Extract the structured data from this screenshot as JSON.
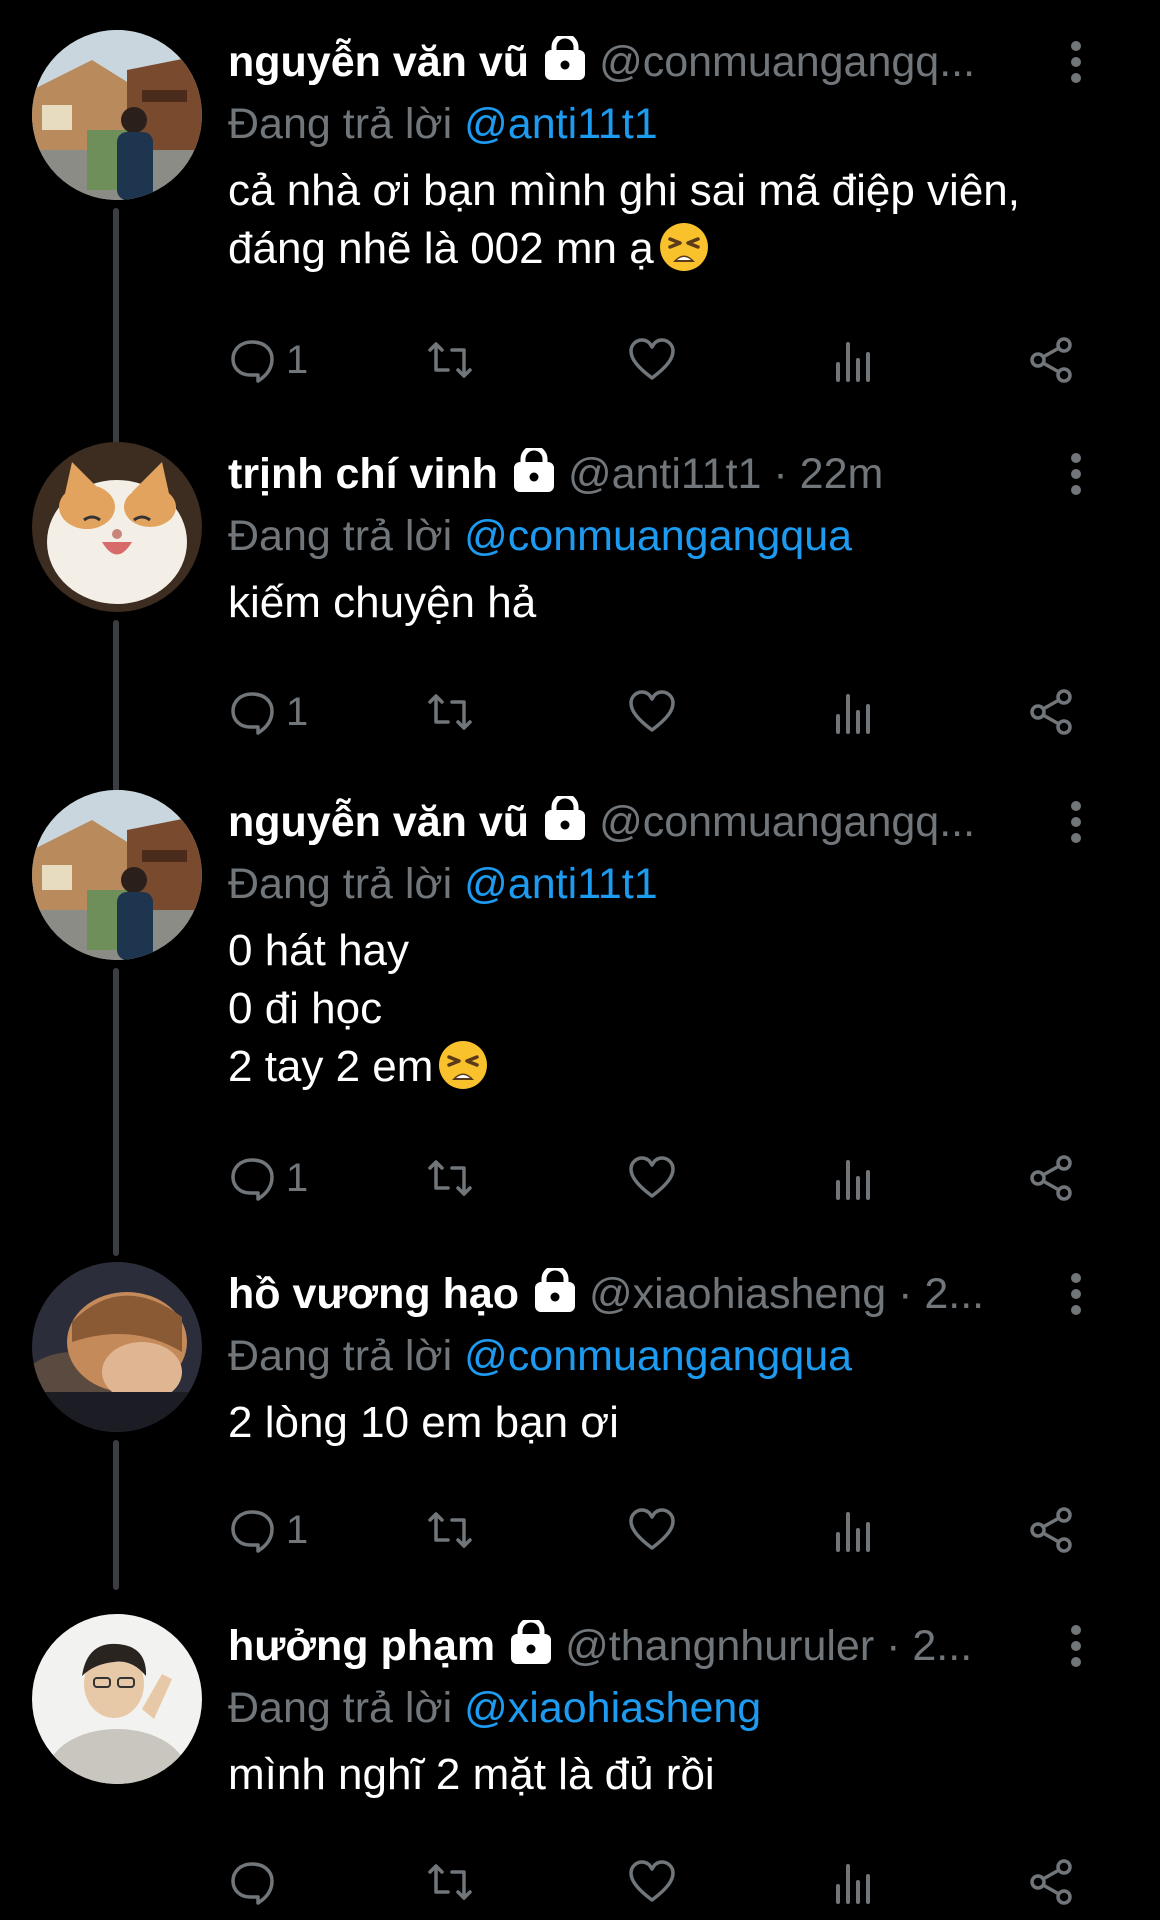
{
  "colors": {
    "background": "#000000",
    "text": "#ffffff",
    "secondary": "#71767b",
    "accent": "#1d9bf0",
    "thread_line": "#3a3d41"
  },
  "reply_prefix": "Đang trả lời",
  "tweets": [
    {
      "name": "nguyễn văn vũ",
      "handle": "@conmuangangq...",
      "meta": "",
      "reply_to": "@anti11t1",
      "text_lines": [
        "cả nhà ơi bạn mình ghi sai mã điệp viên,",
        "đáng nhẽ là 002 mn ạ"
      ],
      "emoji": "tired-face-emoji",
      "reply_count": "1",
      "avatar": "avatar-street-photo"
    },
    {
      "name": "trịnh chí vinh",
      "handle": "@anti11t1",
      "meta": "· 22m",
      "reply_to": "@conmuangangqua",
      "text_lines": [
        "kiếm chuyện hả"
      ],
      "emoji": "",
      "reply_count": "1",
      "avatar": "avatar-cat"
    },
    {
      "name": "nguyễn văn vũ",
      "handle": "@conmuangangq...",
      "meta": "",
      "reply_to": "@anti11t1",
      "text_lines": [
        "0 hát hay",
        "0 đi học",
        "2 tay 2 em"
      ],
      "emoji": "tired-face-emoji",
      "reply_count": "1",
      "avatar": "avatar-street-photo"
    },
    {
      "name": "hồ vương hạo",
      "handle": "@xiaohiasheng",
      "meta": "· 2...",
      "reply_to": "@conmuangangqua",
      "text_lines": [
        "2 lòng 10 em bạn ơi"
      ],
      "emoji": "",
      "reply_count": "1",
      "avatar": "avatar-person-face"
    },
    {
      "name": "hưởng phạm",
      "handle": "@thangnhuruler",
      "meta": "· 2...",
      "reply_to": "@xiaohiasheng",
      "text_lines": [
        "mình nghĩ 2 mặt là đủ rồi"
      ],
      "emoji": "",
      "reply_count": "",
      "avatar": "avatar-person-hoodie"
    }
  ]
}
